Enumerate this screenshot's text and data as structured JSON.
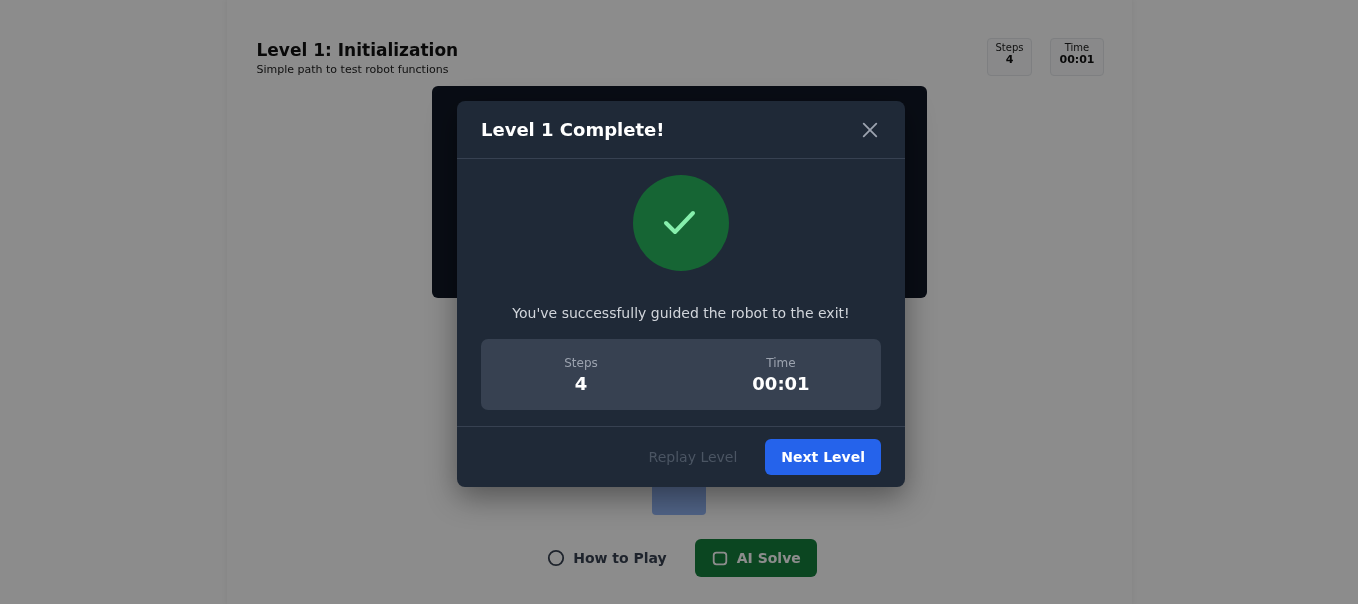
{
  "page": {
    "title": "Level 1: Initialization",
    "subtitle": "Simple path to test robot functions",
    "stats": [
      {
        "label": "Steps",
        "value": "4"
      },
      {
        "label": "Time",
        "value": "00:01"
      }
    ],
    "controls": [
      {
        "label": "How to Play",
        "kind": "link"
      },
      {
        "label": "AI Solve",
        "kind": "solve"
      }
    ]
  },
  "modal": {
    "title": "Level 1 Complete!",
    "message": "You've successfully guided the robot to the exit!",
    "stats": [
      {
        "label": "Steps",
        "value": "4"
      },
      {
        "label": "Time",
        "value": "00:01"
      }
    ],
    "buttons": [
      {
        "label": "Replay Level",
        "kind": "secondary"
      },
      {
        "label": "Next Level",
        "kind": "primary"
      }
    ]
  }
}
